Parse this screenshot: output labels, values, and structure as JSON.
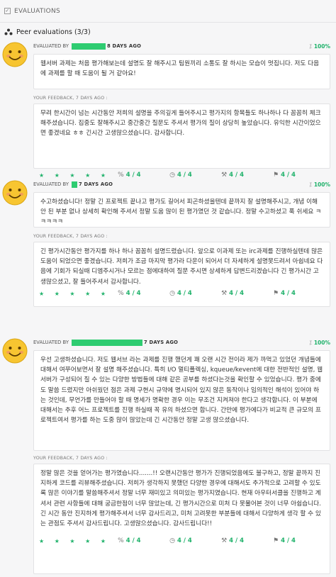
{
  "header": {
    "title": "EVALUATIONS",
    "section_title": "Peer evaluations (3/3)"
  },
  "colors": {
    "accent": "#20b26b",
    "redaction": "#2ecc71"
  },
  "icons": {
    "checkbox": "checkbox-icon",
    "peers": "peers-icon",
    "avatar": "smiley-face-icon",
    "percent": "percent-icon",
    "clock": "clock-icon",
    "hammer": "hammer-icon",
    "flag": "flag-icon"
  },
  "evaluations": [
    {
      "evaluated_label": "EVALUATED BY",
      "ago": "8 DAYS AGO",
      "percent": "100%",
      "comment": "웹서버 과제는 처음 평가해보는데 설명도 잘 해주시고 팀원끼리 소통도 잘 하시는 모습이 멋집니다. 저도 다음에 과제를 할 때 도움이 될 거 같아요!",
      "feedback_label": "YOUR FEEDBACK, 7 DAYS AGO :",
      "feedback": "무려 한시간이 넘는 시간동안 저희의 설명을 주의깊게 들어주시고 평가지의 항목들도 하나하나 다 꼼꼼히 체크해주셨습니다. 집중도 잘해주시고 중간중간 질문도 주셔서 평가의 질이 상당히 높았습니다. 유익한 시간이었으면 좋겠네요 ㅎㅎ 긴시간 고생많으셨습니다. 감사합니다.",
      "stars": "★ ★ ★ ★ ★",
      "scores": [
        "4 / 4",
        "4 / 4",
        "4 / 4",
        "4 / 4"
      ]
    },
    {
      "evaluated_label": "EVALUATED BY",
      "ago": "7 DAYS AGO",
      "percent": "100%",
      "comment": "수고하셨습니다! 정말 긴 프로젝트 끝나고 평가도 길어서 피곤하셨을텐데 끝까지 잘 설명해주시고, 개념 이해 안 된 부분 없나 상세히 확인해 주셔서 정말 도움 많이 된 평가였던 것 같습니다. 정말 수고하셨고 푹 쉬세요 ㅋㅋㅋㅋㅋ",
      "feedback_label": "YOUR FEEDBACK, 7 DAYS AGO :",
      "feedback": "긴 평가시간동안 평가지를 하나 하나 꼼꼼히 설명드렸습니다. 앞으로 이과제 또는 irc과제를 진행하실텐데 많은 도움이 되었으면 좋겠습니다. 저희가 조금 마지막 평가라 다운이 되어서 더 자세하게 설명못드려서 아쉽네요 다음에 기회가 되실때 디엠주시거나 모르는 점에대하여 질문 주시면 상세하게 답변드리겠습니다 긴 평가시간 고생많으셨고, 잘 들어주셔서 감사합니다.",
      "stars": "★ ★ ★ ★ ★",
      "scores": [
        "4 / 4",
        "4 / 4",
        "4 / 4",
        "4 / 4"
      ]
    },
    {
      "evaluated_label": "EVALUATED BY",
      "ago": "7 DAYS AGO",
      "percent": "100%",
      "comment": "우선 고생하셨습니다. 저도 웹서브 라는 과제를 진행 했던게 꽤 오랜 시간 전이라 제가 까먹고 있었던 개념들에 대해서 여쭈어보면서 잘 설명 해주셨습니다. 특히 I/O 멀티플렉싱, kqueue/kevent에 대한 전반적인 설명, 웹서버가 구성되어 질 수 있는 다양한 방법들에 대해 같은 공부를 하셨다는것을 확인할 수 있었습니다. 평가 중에도 말씀 드렸지만 아쉬웠던 점은 과제 구현시 규약에 명시되어 있지 않은 동작이나 임의적인 해석이 있어야 하는 것인데, 무언가를 만들어야 할 때 명세가 명확한 경우 이는 무조건 지켜져야 한다고 생각합니다. 이 부분에 대해서는 추후 어느 프로젝트를 진행 하실때 꼭 유의 하셨으면 합니다. 간만에 평가에다가 비교적 큰 규모의 프로젝트여서 평가를 하는 도중 많이 많았는데 긴 시간동안 정말 고생 많으셨습니다.",
      "feedback_label": "YOUR FEEDBACK, 7 DAYS AGO :",
      "feedback": "정말 많은 것을 얻어가는 평가였습니다.......!! 오랜시간동안 평가가 진행되었음에도 불구하고, 정말 끝까지 진지하게 코드를 리뷰해주셨습니다. 저희가 생각하지 못했던 다양한 경우에 대해서도 추가적으로 고려할 수 있도록 많은 이야기를 말씀해주셔서 정말 너무 재미있고 의미있는 평가지였습니다. 현재 아우터서클을 진행하고 계셔서 관련 사항들에 대해 궁금한점이 너무 많았는데, 긴 평가시간으로 미처 다 못물어본 것이 너무 아쉽습니다. 긴 시간 동안 진지하게 평가해주셔서 너무 감사드리고, 미처 고려못한 부분들에 대해서 다양하게 생각 할 수 있는 관점도 주셔서 감사드립니다. 고생많으셨습니다. 감사드립니다!!",
      "stars": "★ ★ ★ ★ ★",
      "scores": [
        "4 / 4",
        "4 / 4",
        "4 / 4",
        "4 / 4"
      ]
    }
  ]
}
